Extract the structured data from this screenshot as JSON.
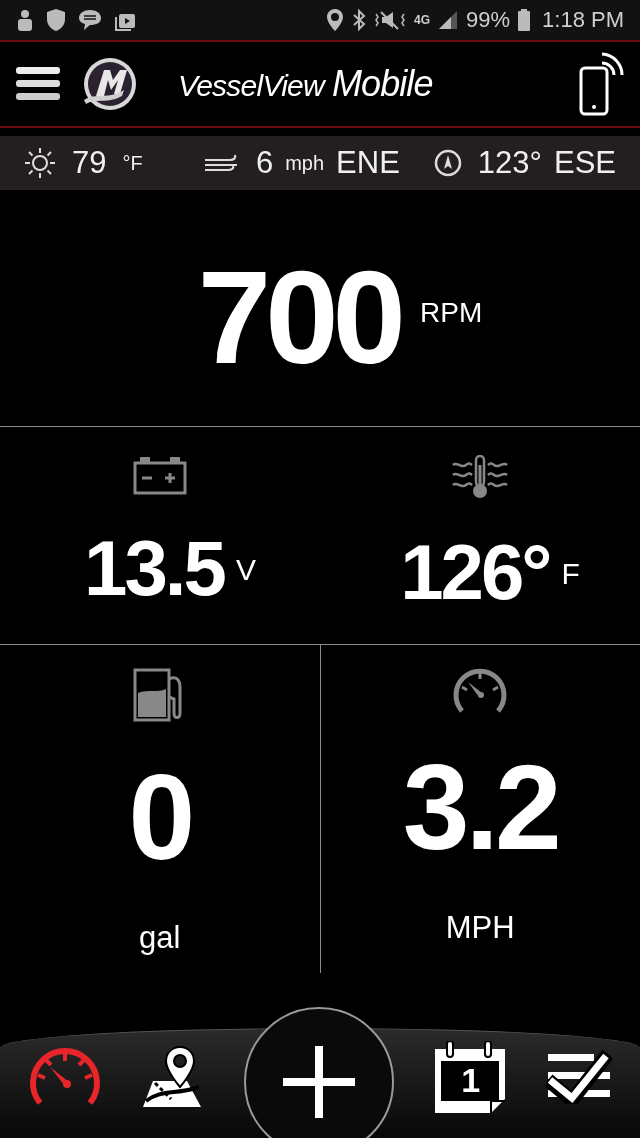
{
  "status_bar": {
    "network": "4G",
    "battery": "99%",
    "time": "1:18 PM"
  },
  "header": {
    "title": "VesselView",
    "title_emphasis": "Mobile"
  },
  "conditions": [
    {
      "kind": "temperature",
      "value": "79",
      "unit": "°F"
    },
    {
      "kind": "wind",
      "value": "6",
      "unit": "mph",
      "direction": "ENE"
    },
    {
      "kind": "heading",
      "value": "123°",
      "direction": "ESE"
    }
  ],
  "rpm": {
    "value": "700",
    "unit": "RPM"
  },
  "gauge_rows": [
    [
      {
        "kind": "battery",
        "value": "13.5",
        "unit": "V"
      },
      {
        "kind": "temperature",
        "value": "126°",
        "unit": "F"
      }
    ],
    [
      {
        "kind": "fuel",
        "value": "0",
        "unit": "gal"
      },
      {
        "kind": "speed",
        "value": "3.2",
        "unit": "MPH"
      }
    ]
  ],
  "nav": [
    {
      "kind": "gauge",
      "selected": true
    },
    {
      "kind": "map",
      "selected": false
    },
    {
      "kind": "add",
      "selected": false
    },
    {
      "kind": "calendar",
      "label": "1",
      "selected": false
    },
    {
      "kind": "checklist",
      "selected": false
    }
  ]
}
